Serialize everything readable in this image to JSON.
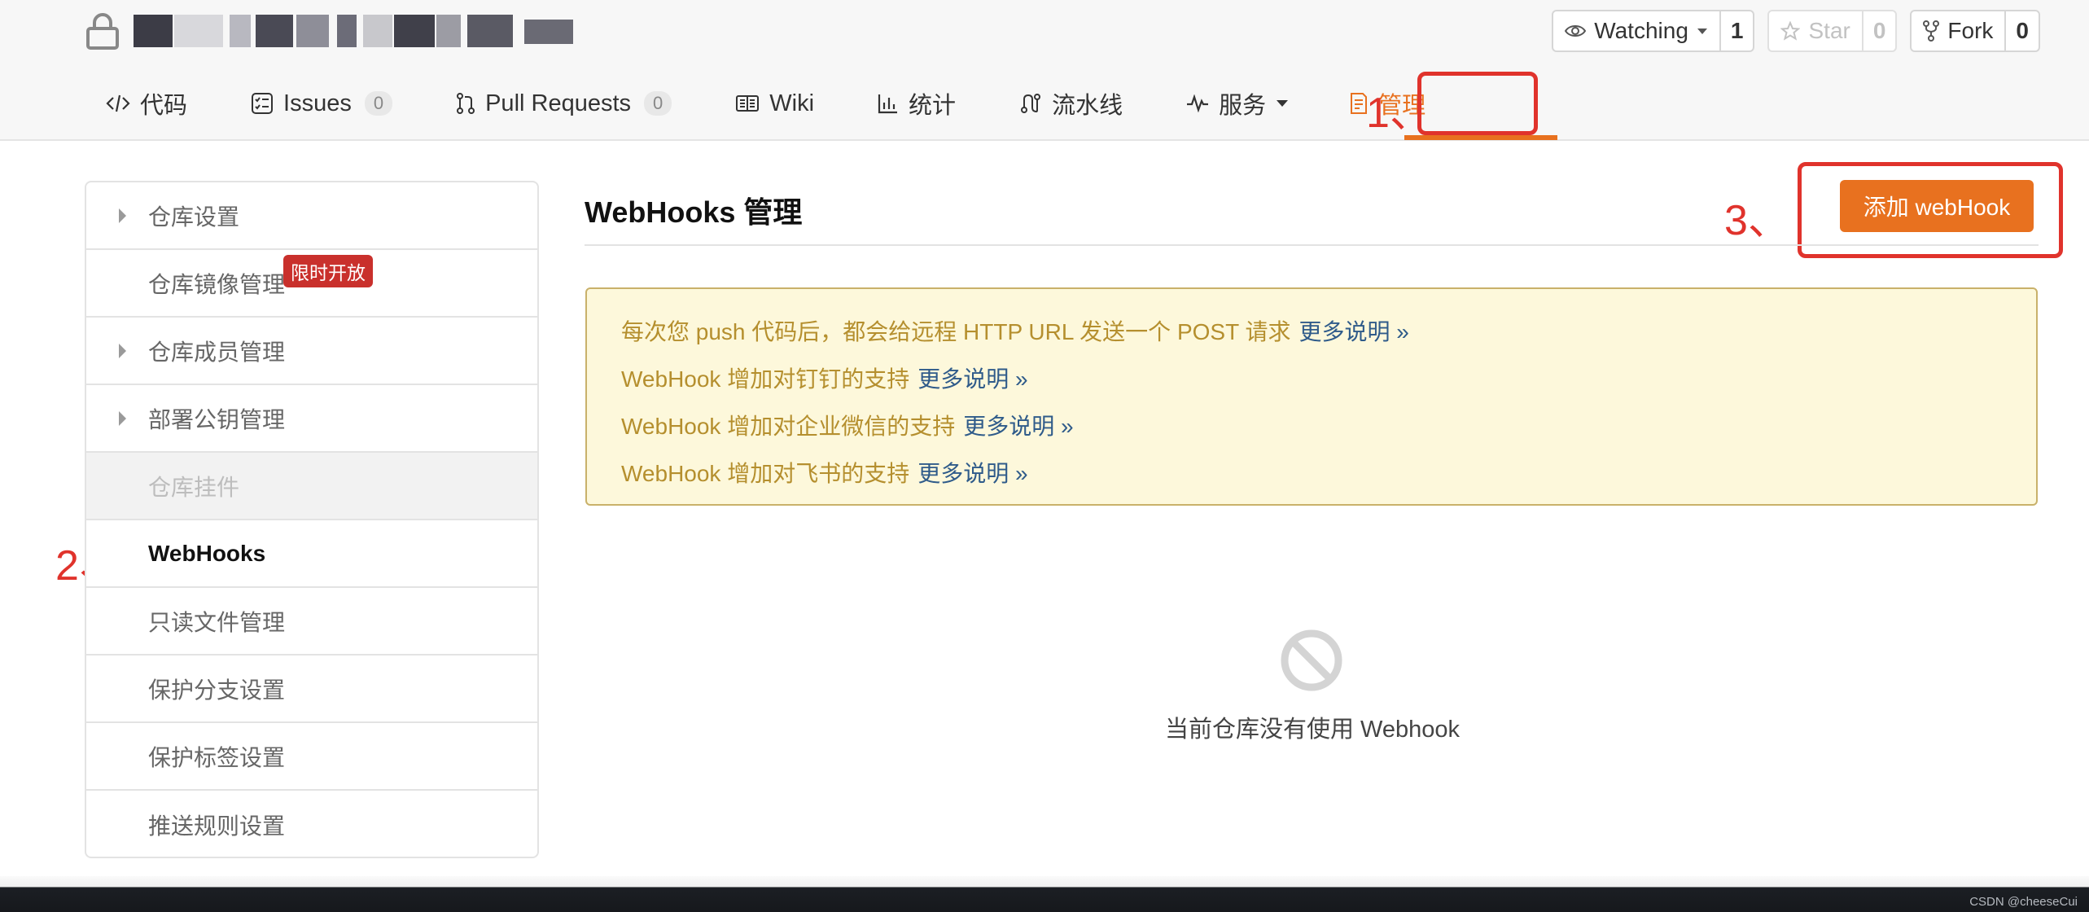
{
  "header": {
    "actions": {
      "watch": {
        "label": "Watching",
        "count": "1"
      },
      "star": {
        "label": "Star",
        "count": "0"
      },
      "fork": {
        "label": "Fork",
        "count": "0"
      }
    },
    "tabs": [
      {
        "label": "代码",
        "icon": "code-icon"
      },
      {
        "label": "Issues",
        "icon": "issues-icon",
        "badge": "0"
      },
      {
        "label": "Pull Requests",
        "icon": "pull-request-icon",
        "badge": "0"
      },
      {
        "label": "Wiki",
        "icon": "wiki-icon"
      },
      {
        "label": "统计",
        "icon": "stats-icon"
      },
      {
        "label": "流水线",
        "icon": "pipeline-icon"
      },
      {
        "label": "服务",
        "icon": "pulse-icon"
      },
      {
        "label": "管理",
        "icon": "manage-icon",
        "active": true
      }
    ]
  },
  "annotations": {
    "one": "1、",
    "two": "2、",
    "three": "3、"
  },
  "sidebar": {
    "items": [
      {
        "label": "仓库设置",
        "caret": true
      },
      {
        "label": "仓库镜像管理",
        "badge": "限时开放"
      },
      {
        "label": "仓库成员管理",
        "caret": true
      },
      {
        "label": "部署公钥管理",
        "caret": true
      },
      {
        "label": "仓库挂件",
        "disabled": true
      },
      {
        "label": "WebHooks",
        "active": true
      },
      {
        "label": "只读文件管理"
      },
      {
        "label": "保护分支设置"
      },
      {
        "label": "保护标签设置"
      },
      {
        "label": "推送规则设置"
      }
    ]
  },
  "main": {
    "title": "WebHooks 管理",
    "add_button": "添加 webHook",
    "notice": [
      {
        "text": "每次您 push 代码后，都会给远程 HTTP URL 发送一个 POST 请求",
        "link": "更多说明 »"
      },
      {
        "text": "WebHook 增加对钉钉的支持",
        "link": "更多说明 »"
      },
      {
        "text": "WebHook 增加对企业微信的支持",
        "link": "更多说明 »"
      },
      {
        "text": "WebHook 增加对飞书的支持",
        "link": "更多说明 »"
      }
    ],
    "empty_text": "当前仓库没有使用 Webhook"
  },
  "footer": {
    "watermark": "CSDN @cheeseCui"
  },
  "colors": {
    "accent": "#e8711f",
    "annotation": "#e0332c",
    "notice_bg": "#fdf8db",
    "notice_text": "#b58f2e",
    "link": "#2f5b8a"
  }
}
